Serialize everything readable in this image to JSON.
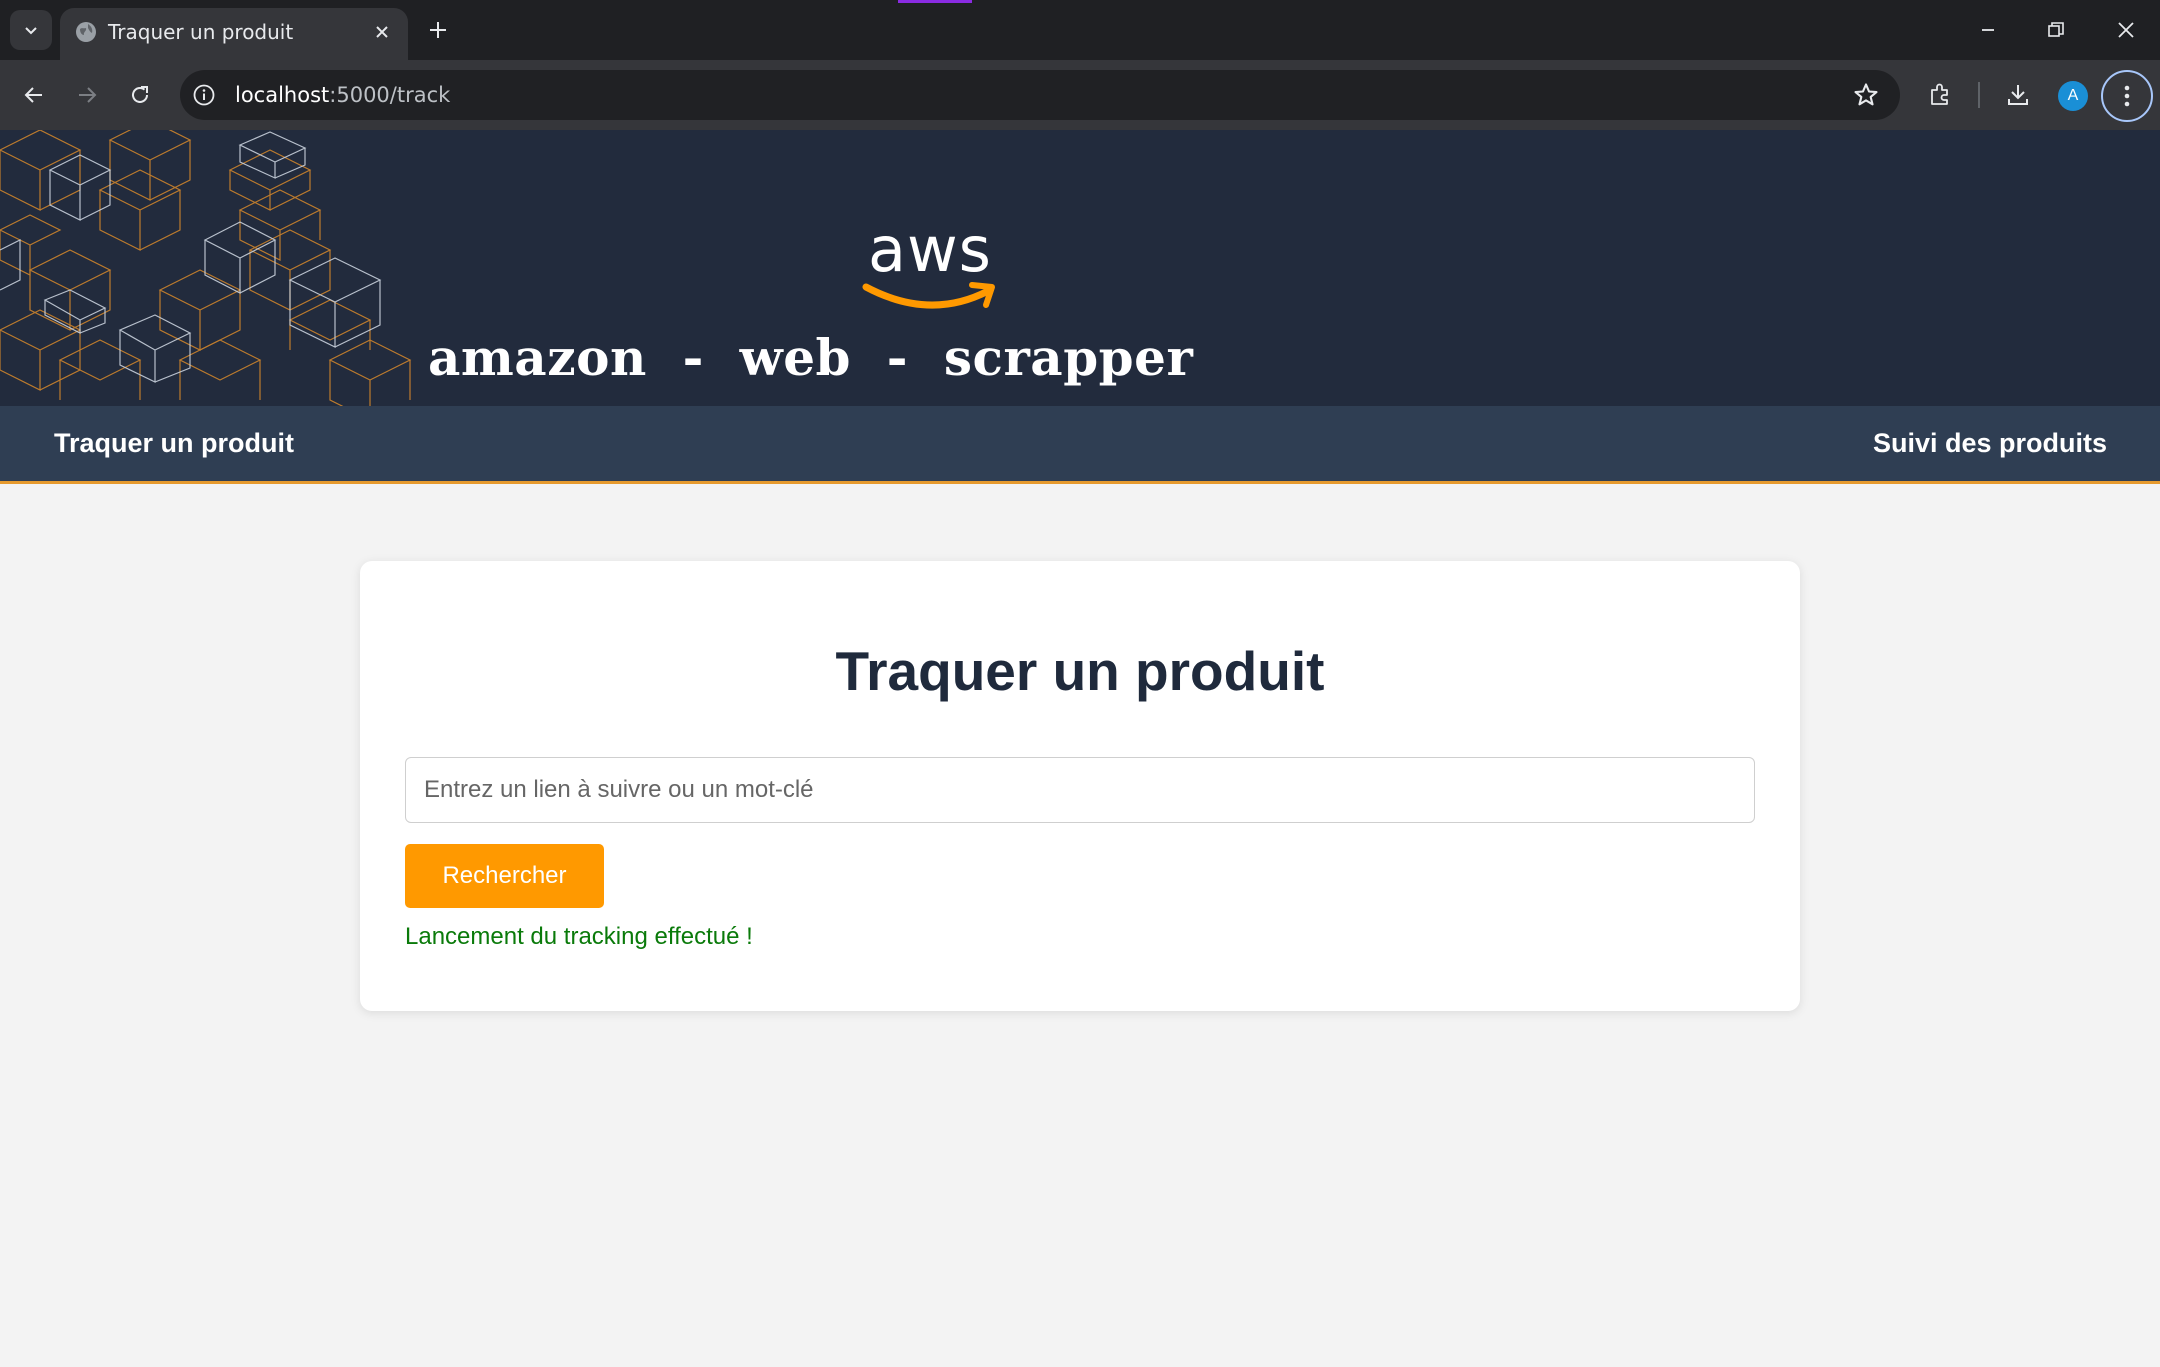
{
  "browser": {
    "tab_title": "Traquer un produit",
    "url_host": "localhost",
    "url_rest": ":5000/track",
    "avatar_letter": "A"
  },
  "header": {
    "logo_text": "aws",
    "site_name": "amazon  -  web  -  scrapper",
    "accent_color": "#ff9900"
  },
  "nav": {
    "left_link": "Traquer un produit",
    "right_link": "Suivi des produits"
  },
  "main": {
    "title": "Traquer un produit",
    "search_placeholder": "Entrez un lien à suivre ou un mot-clé",
    "search_value": "",
    "button_label": "Rechercher",
    "status_message": "Lancement du tracking effectué !",
    "status_color": "#0a7a0a"
  }
}
